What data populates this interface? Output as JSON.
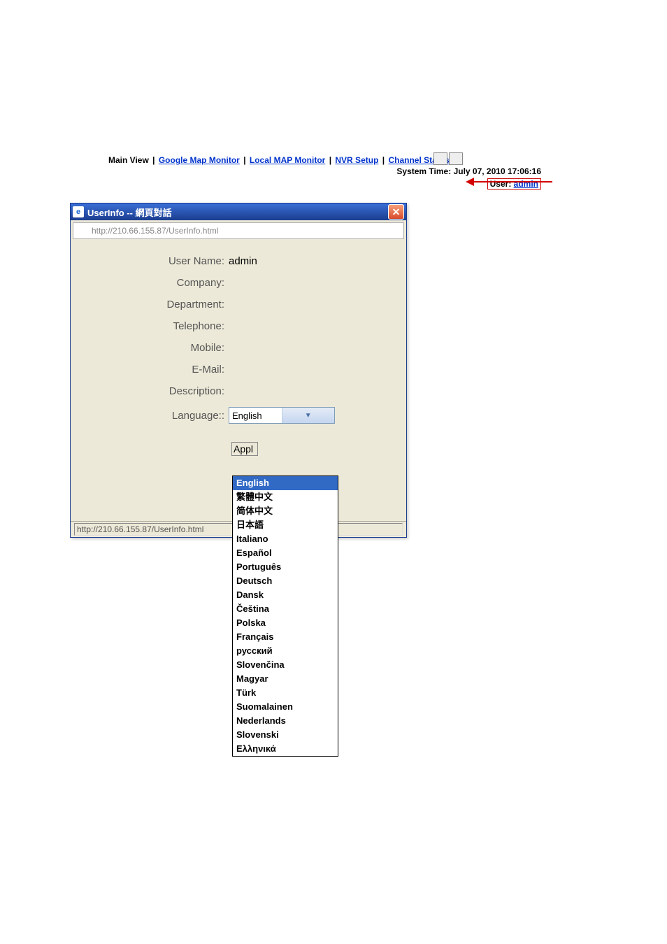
{
  "nav": {
    "main_view": "Main View",
    "google_map": "Google Map Monitor",
    "local_map": "Local MAP Monitor",
    "nvr_setup": "NVR Setup",
    "channel_status": "Channel Status"
  },
  "system_time_label": "System Time: ",
  "system_time_value": "July 07, 2010 17:06:16",
  "user_label": "User: ",
  "user_value": "admin",
  "dialog": {
    "title": "UserInfo -- 網頁對話",
    "url": "http://210.66.155.87/UserInfo.html",
    "fields": {
      "user_name_label": "User Name:",
      "user_name_value": "admin",
      "company_label": "Company:",
      "company_value": "",
      "department_label": "Department:",
      "department_value": "",
      "telephone_label": "Telephone:",
      "telephone_value": "",
      "mobile_label": "Mobile:",
      "mobile_value": "",
      "email_label": "E-Mail:",
      "email_value": "",
      "description_label": "Description:",
      "description_value": "",
      "language_label": "Language::",
      "language_selected": "English"
    },
    "apply_button_partial": "Appl",
    "status_url": "http://210.66.155.87/UserInfo.html"
  },
  "language_options": [
    "English",
    "繁體中文",
    "简体中文",
    "日本語",
    "Italiano",
    "Español",
    "Português",
    "Deutsch",
    "Dansk",
    "Čeština",
    "Polska",
    "Français",
    "русский",
    "Slovenčina",
    "Magyar",
    "Türk",
    "Suomalainen",
    "Nederlands",
    "Slovenski",
    "Ελληνικά"
  ]
}
